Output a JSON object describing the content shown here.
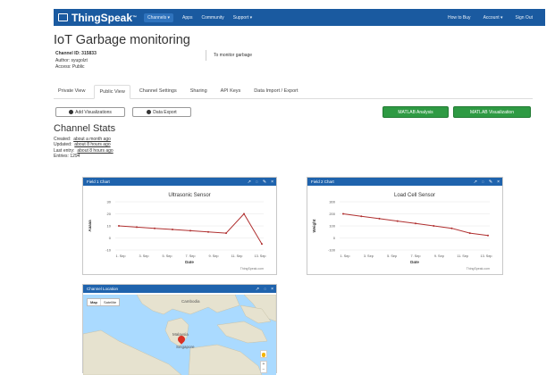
{
  "nav": {
    "brand": "ThingSpeak",
    "channels": "Channels ▾",
    "apps": "Apps",
    "community": "Community",
    "support": "Support ▾",
    "how_to_buy": "How to Buy",
    "account": "Account ▾",
    "sign_out": "Sign Out"
  },
  "channel": {
    "title": "IoT Garbage monitoring",
    "id_label": "Channel ID:",
    "id_value": "315833",
    "author_label": "Author:",
    "author_value": "syugolzt",
    "access_label": "Access:",
    "access_value": "Public",
    "description": "To monitor garbage"
  },
  "tabs": [
    "Private View",
    "Public View",
    "Channel Settings",
    "Sharing",
    "API Keys",
    "Data Import / Export"
  ],
  "buttons": {
    "add_visualizations": "Add Visualizations",
    "data_export": "Data Export",
    "matlab_analysis": "MATLAB Analysis",
    "matlab_visualization": "MATLAB Visualization"
  },
  "stats": {
    "title": "Channel Stats",
    "created_label": "Created:",
    "created_value": "about a month ago",
    "updated_label": "Updated:",
    "updated_value": "about 8 hours ago",
    "last_entry_label": "Last entry:",
    "last_entry_value": "about 8 hours ago",
    "entries_label": "Entries:",
    "entries_value": "1294"
  },
  "panels": {
    "field1_title": "Field 1 Chart",
    "field2_title": "Field 2 Chart",
    "location_title": "Channel Location",
    "credit": "ThingSpeak.com"
  },
  "map": {
    "map_btn": "Map",
    "sat_btn": "Satellite",
    "labels": [
      "Cambodia",
      "Malaysia",
      "Singapore"
    ]
  },
  "chart_data": [
    {
      "type": "line",
      "title": "Ultrasonic Sensor",
      "xlabel": "Date",
      "ylabel": "Aaaaa",
      "x": [
        "1. Sep",
        "3. Sep",
        "5. Sep",
        "7. Sep",
        "9. Sep",
        "11. Sep",
        "13. Sep"
      ],
      "yticks": [
        30,
        20,
        10,
        0,
        -10
      ],
      "ylim": [
        -10,
        30
      ],
      "series": [
        {
          "values": [
            10,
            9,
            8,
            7,
            6,
            5,
            4,
            20,
            -5
          ]
        }
      ],
      "color": "#b03030"
    },
    {
      "type": "line",
      "title": "Load Cell Sensor",
      "xlabel": "Date",
      "ylabel": "Weight",
      "x": [
        "1. Sep",
        "3. Sep",
        "5. Sep",
        "7. Sep",
        "9. Sep",
        "11. Sep",
        "13. Sep"
      ],
      "yticks": [
        300,
        200,
        100,
        0,
        -100
      ],
      "ylim": [
        -100,
        300
      ],
      "series": [
        {
          "values": [
            200,
            180,
            160,
            140,
            120,
            100,
            80,
            40,
            20
          ]
        }
      ],
      "color": "#b03030"
    }
  ]
}
